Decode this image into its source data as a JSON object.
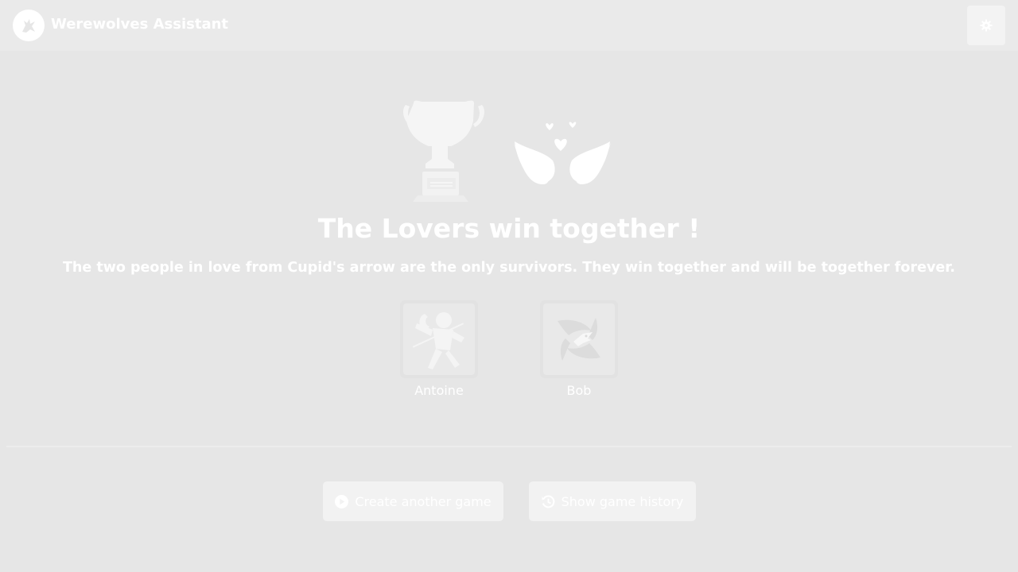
{
  "header": {
    "app_title": "Werewolves Assistant",
    "logo_icon": "wolf-howling-icon",
    "settings_icon": "gear-icon"
  },
  "result": {
    "icons": [
      "trophy-icon",
      "lovebirds-icon"
    ],
    "title": "The Lovers win together !",
    "description": "The two people in love from Cupid's arrow are the only survivors. They win together and will be together forever."
  },
  "players": [
    {
      "name": "Antoine",
      "role_icon": "cupid-icon"
    },
    {
      "name": "Bob",
      "role_icon": "werewolf-icon"
    }
  ],
  "actions": {
    "create_label": "Create another game",
    "create_icon": "play-circle-icon",
    "history_label": "Show game history",
    "history_icon": "history-icon"
  },
  "colors": {
    "background": "#e6e6e6",
    "navbar": "#eaeaea",
    "button": "#f2f2f2",
    "text": "#ffffff"
  }
}
